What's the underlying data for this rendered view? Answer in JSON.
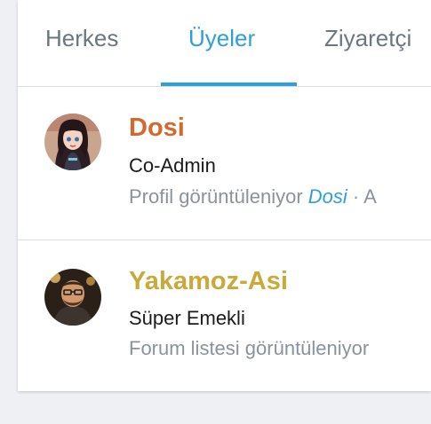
{
  "tabs": [
    {
      "label": "Herkes",
      "active": false
    },
    {
      "label": "Üyeler",
      "active": true
    },
    {
      "label": "Ziyaretçi",
      "active": false
    }
  ],
  "members": [
    {
      "username": "Dosi",
      "username_color": "#d4692f",
      "title": "Co-Admin",
      "activity_prefix": "Profil görüntüleniyor ",
      "activity_link": "Dosi",
      "activity_suffix": " · A"
    },
    {
      "username": "Yakamoz-Asi",
      "username_color": "#c9a93a",
      "title": "Süper Emekli",
      "activity_prefix": "Forum listesi görüntüleniyor",
      "activity_link": "",
      "activity_suffix": ""
    }
  ],
  "colors": {
    "accent": "#2d9fd9",
    "muted": "#8a939c",
    "tab_inactive": "#6b7680"
  }
}
